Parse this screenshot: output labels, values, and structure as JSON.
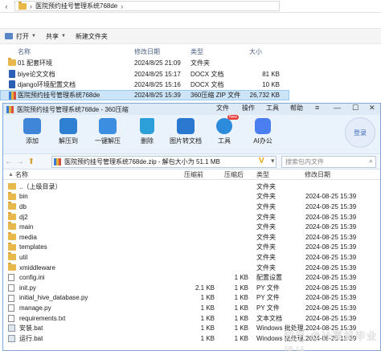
{
  "explorer": {
    "breadcrumb": "医院预约挂号管理系统768de",
    "toolbar": {
      "organize": "打开",
      "share": "共享",
      "new_folder": "新建文件夹"
    },
    "columns": {
      "name": "名称",
      "date": "修改日期",
      "type": "类型",
      "size": "大小"
    },
    "rows": [
      {
        "name": "01 配套环境",
        "date": "2024/8/25 21:09",
        "type": "文件夹",
        "size": "",
        "icon": "folder-icon"
      },
      {
        "name": "biye论文文档",
        "date": "2024/8/25 15:17",
        "type": "DOCX 文档",
        "size": "81 KB",
        "icon": "word-doc-icon"
      },
      {
        "name": "django环境配置文档",
        "date": "2024/8/25 15:16",
        "type": "DOCX 文档",
        "size": "10 KB",
        "icon": "word-doc-icon"
      },
      {
        "name": "医院预约挂号管理系统768de",
        "date": "2024/8/25 15:39",
        "type": "360压缩 ZIP 文件",
        "size": "26,732 KB",
        "icon": "zip-icon",
        "selected": true
      }
    ]
  },
  "zip": {
    "title": "医院预约挂号管理系统768de - 360压缩",
    "menu": {
      "file": "文件",
      "ops": "操作",
      "tools": "工具",
      "help": "帮助"
    },
    "toolbar": [
      {
        "label": "添加",
        "icon": "add-icon",
        "color": "#3f86d8"
      },
      {
        "label": "解压到",
        "icon": "extract-to-icon",
        "color": "#2f7fd2"
      },
      {
        "label": "一键解压",
        "icon": "one-click-extract-icon",
        "color": "#3b8ee0"
      },
      {
        "label": "删除",
        "icon": "delete-icon",
        "color": "#2c9fd9"
      },
      {
        "label": "图片转文档",
        "icon": "image-to-doc-icon",
        "color": "#2b78d0"
      },
      {
        "label": "工具",
        "icon": "tools-icon",
        "color": "#2d8bdb",
        "badge": "New"
      },
      {
        "label": "AI办公",
        "icon": "ai-office-icon",
        "color": "#4b7ff0"
      }
    ],
    "login": "登录",
    "path": "医院预约挂号管理系统768de.zip - 解包大小为 51.1 MB",
    "search_placeholder": "搜索包内文件",
    "columns": {
      "name": "名称",
      "compressed": "压缩前",
      "uncompressed": "压缩后",
      "type": "类型",
      "modified": "修改日期"
    },
    "rows": [
      {
        "name": "..（上级目录）",
        "compressed": "",
        "uncompressed": "",
        "type": "文件夹",
        "date": "",
        "icon": "parent-folder-icon"
      },
      {
        "name": "bin",
        "compressed": "",
        "uncompressed": "",
        "type": "文件夹",
        "date": "2024-08-25 15:39",
        "icon": "folder-icon"
      },
      {
        "name": "db",
        "compressed": "",
        "uncompressed": "",
        "type": "文件夹",
        "date": "2024-08-25 15:39",
        "icon": "folder-icon"
      },
      {
        "name": "dj2",
        "compressed": "",
        "uncompressed": "",
        "type": "文件夹",
        "date": "2024-08-25 15:39",
        "icon": "folder-icon"
      },
      {
        "name": "main",
        "compressed": "",
        "uncompressed": "",
        "type": "文件夹",
        "date": "2024-08-25 15:39",
        "icon": "folder-icon"
      },
      {
        "name": "media",
        "compressed": "",
        "uncompressed": "",
        "type": "文件夹",
        "date": "2024-08-25 15:39",
        "icon": "folder-icon"
      },
      {
        "name": "templates",
        "compressed": "",
        "uncompressed": "",
        "type": "文件夹",
        "date": "2024-08-25 15:39",
        "icon": "folder-icon"
      },
      {
        "name": "util",
        "compressed": "",
        "uncompressed": "",
        "type": "文件夹",
        "date": "2024-08-25 15:39",
        "icon": "folder-icon"
      },
      {
        "name": "xmiddleware",
        "compressed": "",
        "uncompressed": "",
        "type": "文件夹",
        "date": "2024-08-25 15:39",
        "icon": "folder-icon"
      },
      {
        "name": "config.ini",
        "compressed": "",
        "uncompressed": "1 KB",
        "type": "配置设置",
        "date": "2024-08-25 15:39",
        "icon": "file-icon"
      },
      {
        "name": "init.py",
        "compressed": "2.1 KB",
        "uncompressed": "1 KB",
        "type": "PY 文件",
        "date": "2024-08-25 15:39",
        "icon": "file-icon"
      },
      {
        "name": "initial_hive_database.py",
        "compressed": "1 KB",
        "uncompressed": "1 KB",
        "type": "PY 文件",
        "date": "2024-08-25 15:39",
        "icon": "file-icon"
      },
      {
        "name": "manage.py",
        "compressed": "1 KB",
        "uncompressed": "1 KB",
        "type": "PY 文件",
        "date": "2024-08-25 15:39",
        "icon": "file-icon"
      },
      {
        "name": "requirements.txt",
        "compressed": "1 KB",
        "uncompressed": "1 KB",
        "type": "文本文档",
        "date": "2024-08-25 15:39",
        "icon": "file-icon"
      },
      {
        "name": "安装.bat",
        "compressed": "1 KB",
        "uncompressed": "1 KB",
        "type": "Windows 批处理...",
        "date": "2024-08-25 15:39",
        "icon": "bat-icon"
      },
      {
        "name": "运行.bat",
        "compressed": "1 KB",
        "uncompressed": "1 KB",
        "type": "Windows 批处理...",
        "date": "2024-08-25 15:39",
        "icon": "bat-icon"
      }
    ]
  },
  "watermark": "知乎 @计算机毕业设计"
}
